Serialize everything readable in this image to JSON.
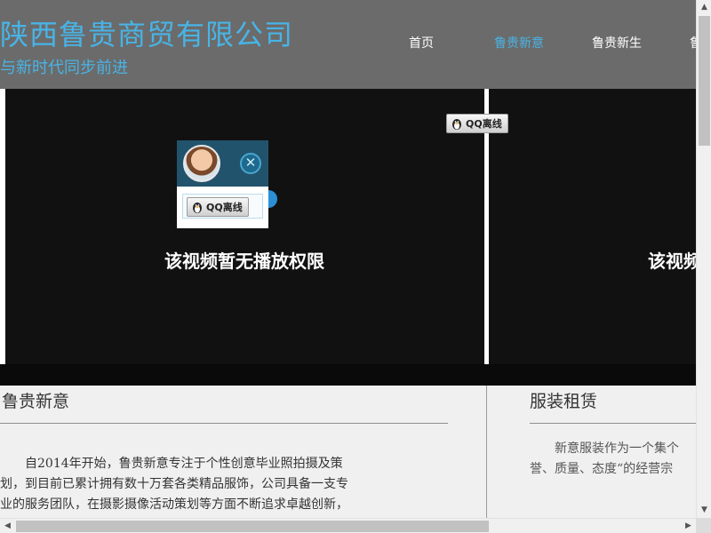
{
  "header": {
    "title": "陕西鲁贵商贸有限公司",
    "slogan": "与新时代同步前进",
    "colors": {
      "background": "#6b6b6b",
      "brand": "#48b4e6",
      "nav_text": "#ffffff"
    }
  },
  "nav": {
    "items": [
      {
        "label": "首页",
        "active": false
      },
      {
        "label": "鲁贵新意",
        "active": true
      },
      {
        "label": "鲁贵新生",
        "active": false
      },
      {
        "label": "鲁",
        "active": false
      }
    ]
  },
  "videos": [
    {
      "message": "该视频暂无播放权限"
    },
    {
      "message": "该视频暂无播放权限"
    }
  ],
  "qq": {
    "status_label": "QQ离线",
    "close_symbol": "✕",
    "icons": {
      "penguin": "qq-penguin-icon",
      "close": "close-icon",
      "avatar": "customer-service-avatar"
    }
  },
  "sections": {
    "left": {
      "title": "鲁贵新意",
      "paragraph_lines": [
        "　　自2014年开始，鲁贵新意专注于个性创意毕业照拍摄及策",
        "划，到目前已累计拥有数十万套各类精品服饰，公司具备一支专",
        "业的服务团队，在摄影摄像活动策划等方面不断追求卓越创新，"
      ]
    },
    "right": {
      "title": "服装租赁",
      "paragraph_lines": [
        "　　新意服装作为一个集个",
        "誉、质量、态度“的经营宗"
      ]
    }
  },
  "scrollbars": {
    "up_arrow": "▲",
    "down_arrow": "▼",
    "left_arrow": "◀",
    "right_arrow": "▶"
  }
}
